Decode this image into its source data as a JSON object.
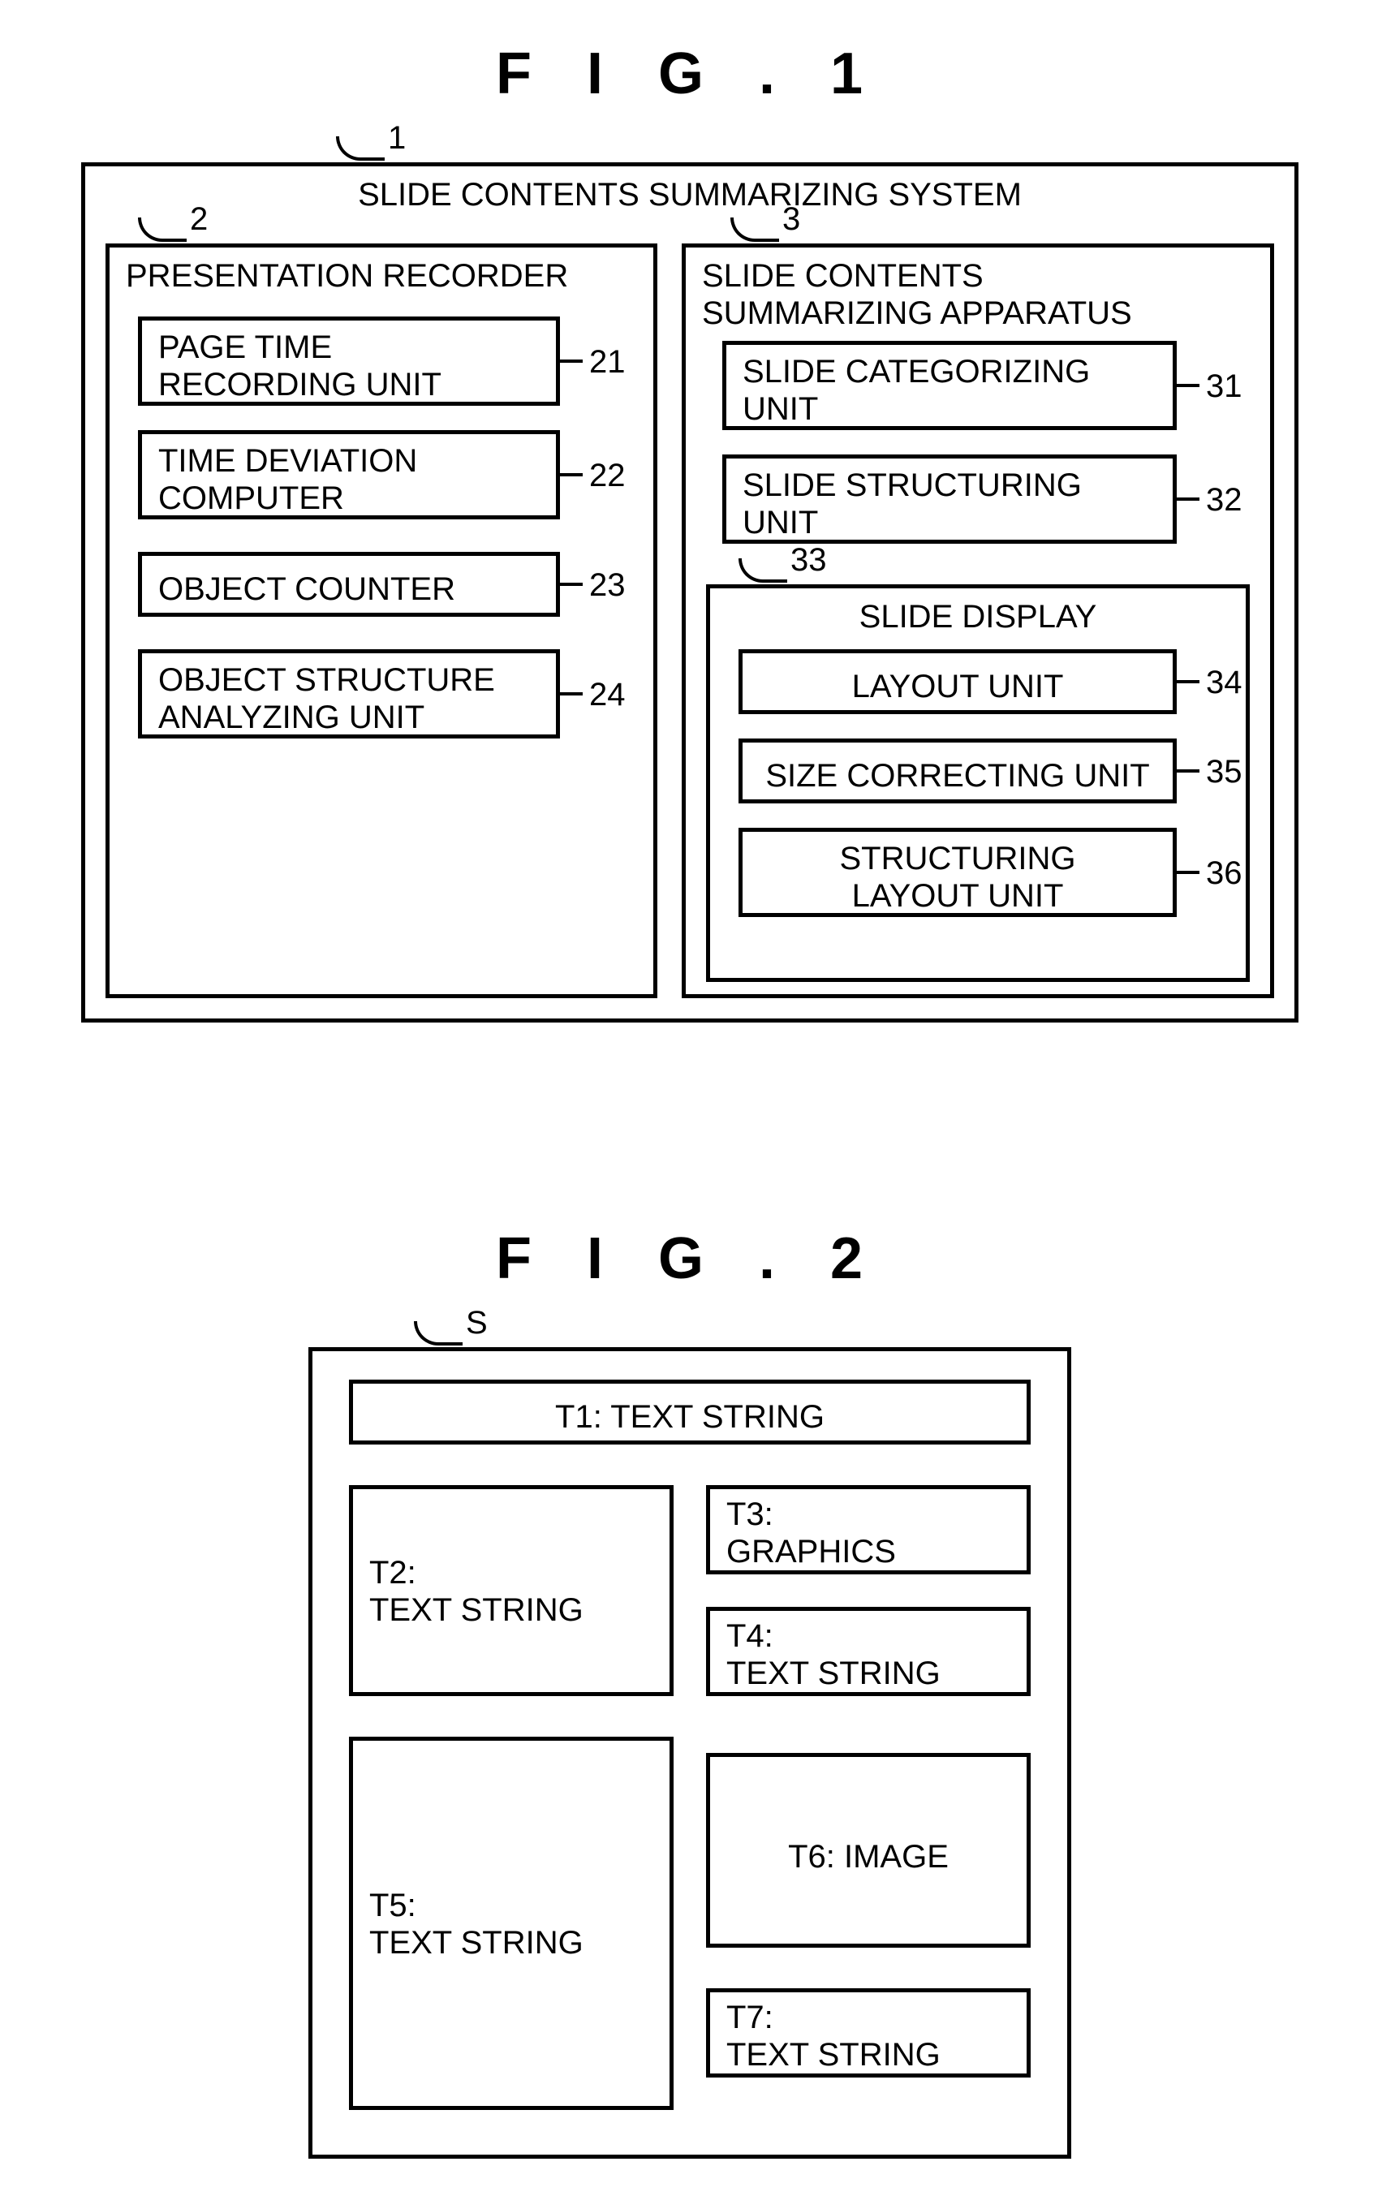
{
  "fig1": {
    "title": "F I G . 1",
    "ref_1": "1",
    "system_title": "SLIDE CONTENTS SUMMARIZING SYSTEM",
    "ref_2": "2",
    "left_title": "PRESENTATION RECORDER",
    "b21": "PAGE TIME\nRECORDING UNIT",
    "r21": "21",
    "b22": "TIME DEVIATION\nCOMPUTER",
    "r22": "22",
    "b23": "OBJECT COUNTER",
    "r23": "23",
    "b24": "OBJECT STRUCTURE\nANALYZING UNIT",
    "r24": "24",
    "ref_3": "3",
    "right_title": "SLIDE CONTENTS\nSUMMARIZING APPARATUS",
    "b31": "SLIDE CATEGORIZING\nUNIT",
    "r31": "31",
    "b32": "SLIDE STRUCTURING\nUNIT",
    "r32": "32",
    "r33": "33",
    "slide_display": "SLIDE DISPLAY",
    "b34": "LAYOUT UNIT",
    "r34": "34",
    "b35": "SIZE CORRECTING UNIT",
    "r35": "35",
    "b36": "STRUCTURING\nLAYOUT UNIT",
    "r36": "36"
  },
  "fig2": {
    "title": "F I G . 2",
    "ref_s": "S",
    "t1": "T1: TEXT STRING",
    "t2": "T2:\nTEXT STRING",
    "t3": "T3:\nGRAPHICS",
    "t4": "T4:\nTEXT STRING",
    "t5": "T5:\nTEXT STRING",
    "t6": "T6: IMAGE",
    "t7": "T7:\nTEXT STRING"
  }
}
